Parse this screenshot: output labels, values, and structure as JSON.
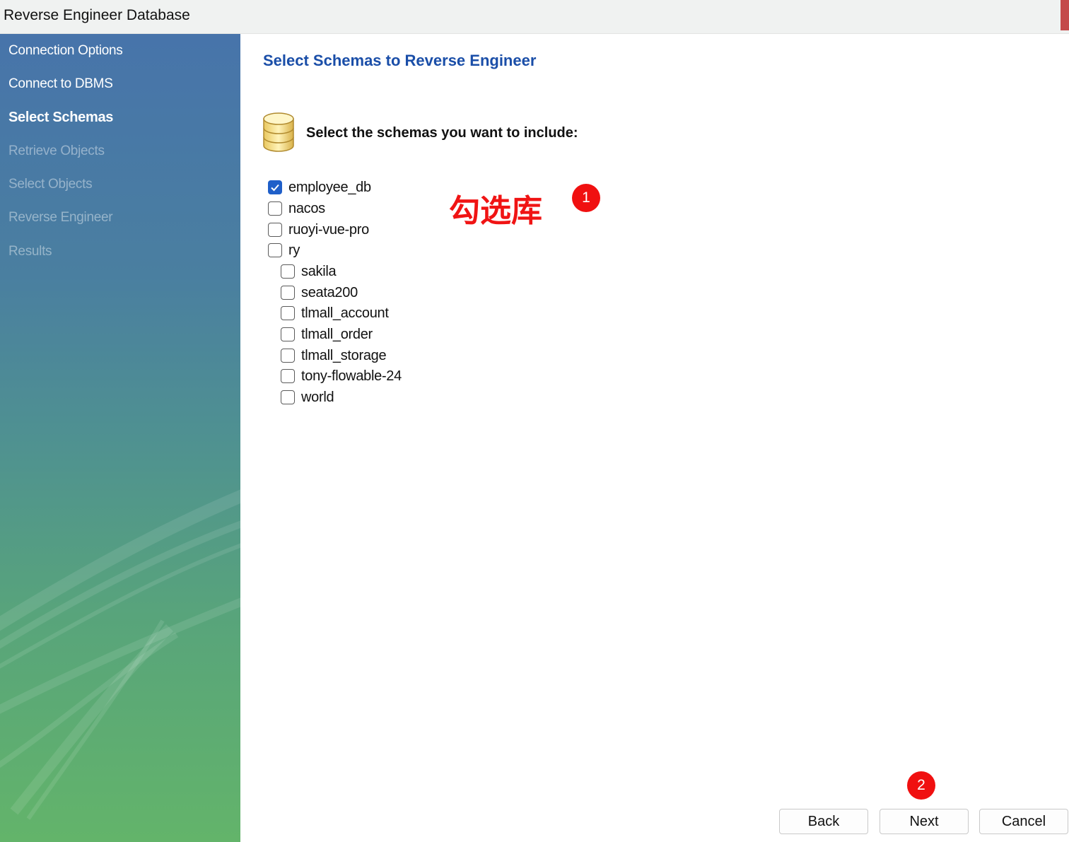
{
  "window": {
    "title": "Reverse Engineer Database"
  },
  "steps": [
    {
      "label": "Connection Options",
      "state": "done"
    },
    {
      "label": "Connect to DBMS",
      "state": "done"
    },
    {
      "label": "Select Schemas",
      "state": "active"
    },
    {
      "label": "Retrieve Objects",
      "state": "pending"
    },
    {
      "label": "Select Objects",
      "state": "pending"
    },
    {
      "label": "Reverse Engineer",
      "state": "pending"
    },
    {
      "label": "Results",
      "state": "pending"
    }
  ],
  "main": {
    "heading": "Select Schemas to Reverse Engineer",
    "prompt": "Select the schemas you want to include:",
    "icon": "database-icon"
  },
  "schemas": [
    {
      "name": "employee_db",
      "checked": true
    },
    {
      "name": "nacos",
      "checked": false
    },
    {
      "name": "ruoyi-vue-pro",
      "checked": false
    },
    {
      "name": "ry",
      "checked": false
    },
    {
      "name": "sakila",
      "checked": false
    },
    {
      "name": "seata200",
      "checked": false
    },
    {
      "name": "tlmall_account",
      "checked": false
    },
    {
      "name": "tlmall_order",
      "checked": false
    },
    {
      "name": "tlmall_storage",
      "checked": false
    },
    {
      "name": "tony-flowable-24",
      "checked": false
    },
    {
      "name": "world",
      "checked": false
    }
  ],
  "annotations": {
    "select_text": "勾选库",
    "badge1": "1",
    "badge2": "2",
    "color": "#f01010"
  },
  "buttons": {
    "back": "Back",
    "next": "Next",
    "cancel": "Cancel"
  },
  "colors": {
    "heading": "#1a4ea8",
    "checkbox_checked": "#1f5fc9"
  }
}
